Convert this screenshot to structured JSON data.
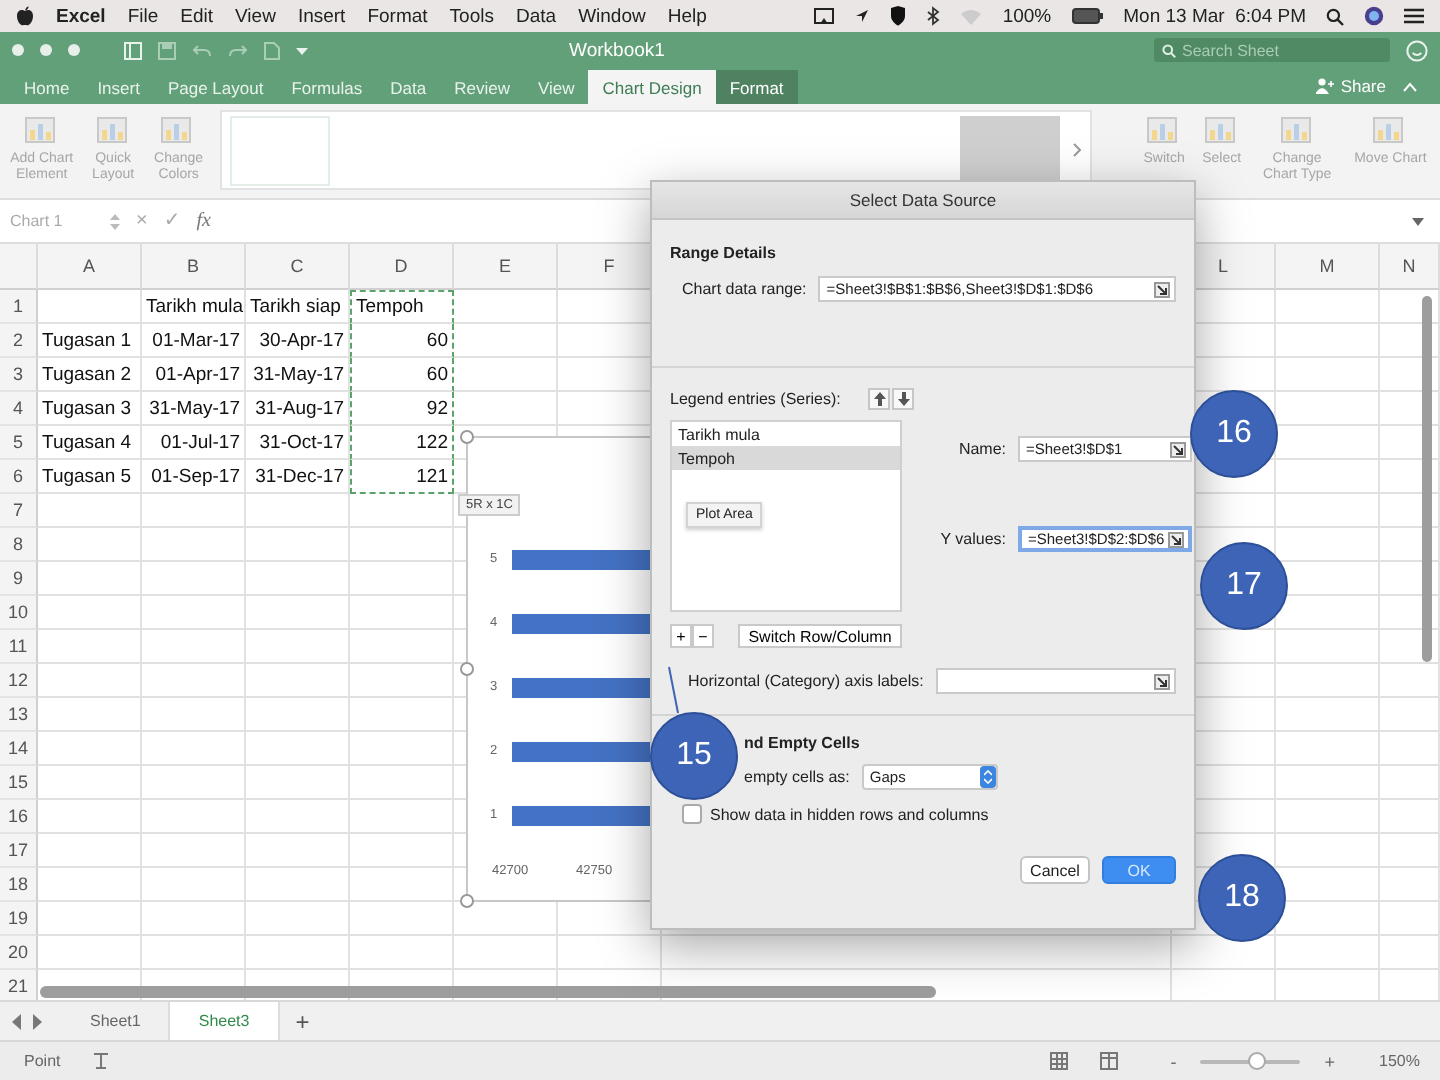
{
  "menu_bar": {
    "app": "Excel",
    "items": [
      "File",
      "Edit",
      "View",
      "Insert",
      "Format",
      "Tools",
      "Data",
      "Window",
      "Help"
    ],
    "battery": "100%",
    "clock": "Mon 13 Mar  6:04 PM"
  },
  "title_bar": {
    "title": "Workbook1",
    "search": {
      "placeholder": "Search Sheet"
    }
  },
  "ribbon_tabs": [
    {
      "label": "Home",
      "selected": false,
      "kind": "normal"
    },
    {
      "label": "Insert",
      "selected": false,
      "kind": "normal"
    },
    {
      "label": "Page Layout",
      "selected": false,
      "kind": "normal"
    },
    {
      "label": "Formulas",
      "selected": false,
      "kind": "normal"
    },
    {
      "label": "Data",
      "selected": false,
      "kind": "normal"
    },
    {
      "label": "Review",
      "selected": false,
      "kind": "normal"
    },
    {
      "label": "View",
      "selected": false,
      "kind": "normal"
    },
    {
      "label": "Chart Design",
      "selected": true,
      "kind": "contextual"
    },
    {
      "label": "Format",
      "selected": false,
      "kind": "contextual"
    }
  ],
  "share": "Share",
  "ribbon": {
    "left": [
      "Add Chart Element",
      "Quick Layout",
      "Change Colors"
    ],
    "right": [
      "Switch",
      "Select",
      "Change Chart Type",
      "Move Chart"
    ]
  },
  "formula_bar": {
    "name_box": "Chart 1",
    "cancel": "×",
    "enter": "✓",
    "fx": "fx"
  },
  "sheet": {
    "columns_left": [
      "A",
      "B",
      "C",
      "D",
      "E",
      "F"
    ],
    "columns_right": [
      "L",
      "M",
      "N"
    ],
    "rows": [
      {
        "label": "1",
        "cells": [
          null,
          {
            "text": "Tarikh mula",
            "kind": "text",
            "in_range": false
          },
          {
            "text": "Tarikh siap",
            "kind": "text",
            "in_range": false
          },
          {
            "text": "Tempoh",
            "kind": "text",
            "in_range": true
          }
        ]
      },
      {
        "label": "2",
        "cells": [
          {
            "text": "Tugasan 1",
            "kind": "text",
            "in_range": false
          },
          {
            "text": "01-Mar-17",
            "kind": "number",
            "in_range": false
          },
          {
            "text": "30-Apr-17",
            "kind": "number",
            "in_range": false
          },
          {
            "text": "60",
            "kind": "number",
            "in_range": true
          }
        ]
      },
      {
        "label": "3",
        "cells": [
          {
            "text": "Tugasan 2",
            "kind": "text",
            "in_range": false
          },
          {
            "text": "01-Apr-17",
            "kind": "number",
            "in_range": false
          },
          {
            "text": "31-May-17",
            "kind": "number",
            "in_range": false
          },
          {
            "text": "60",
            "kind": "number",
            "in_range": true
          }
        ]
      },
      {
        "label": "4",
        "cells": [
          {
            "text": "Tugasan 3",
            "kind": "text",
            "in_range": false
          },
          {
            "text": "31-May-17",
            "kind": "number",
            "in_range": false
          },
          {
            "text": "31-Aug-17",
            "kind": "number",
            "in_range": false
          },
          {
            "text": "92",
            "kind": "number",
            "in_range": true
          }
        ]
      },
      {
        "label": "5",
        "cells": [
          {
            "text": "Tugasan 4",
            "kind": "text",
            "in_range": false
          },
          {
            "text": "01-Jul-17",
            "kind": "number",
            "in_range": false
          },
          {
            "text": "31-Oct-17",
            "kind": "number",
            "in_range": false
          },
          {
            "text": "122",
            "kind": "number",
            "in_range": true
          }
        ]
      },
      {
        "label": "6",
        "cells": [
          {
            "text": "Tugasan 5",
            "kind": "text",
            "in_range": false
          },
          {
            "text": "01-Sep-17",
            "kind": "number",
            "in_range": false
          },
          {
            "text": "31-Dec-17",
            "kind": "number",
            "in_range": false
          },
          {
            "text": "121",
            "kind": "number",
            "in_range": true
          }
        ]
      },
      {
        "label": "7",
        "cells": []
      },
      {
        "label": "8",
        "cells": []
      },
      {
        "label": "9",
        "cells": []
      },
      {
        "label": "10",
        "cells": []
      },
      {
        "label": "11",
        "cells": []
      },
      {
        "label": "12",
        "cells": []
      },
      {
        "label": "13",
        "cells": []
      },
      {
        "label": "14",
        "cells": []
      },
      {
        "label": "15",
        "cells": []
      },
      {
        "label": "16",
        "cells": []
      },
      {
        "label": "17",
        "cells": []
      },
      {
        "label": "18",
        "cells": []
      },
      {
        "label": "19",
        "cells": []
      },
      {
        "label": "20",
        "cells": []
      },
      {
        "label": "21",
        "cells": []
      }
    ]
  },
  "chart": {
    "tooltip": "5R x 1C",
    "category_labels": [
      "5",
      "4",
      "3",
      "2",
      "1"
    ],
    "axis_labels": [
      "42700",
      "42750"
    ]
  },
  "dialog": {
    "title": "Select Data Source",
    "range_heading": "Range Details",
    "chart_range": {
      "label": "Chart data range:",
      "value": "=Sheet3!$B$1:$B$6,Sheet3!$D$1:$D$6"
    },
    "legend_label": "Legend entries (Series):",
    "series": [
      {
        "label": "Tarikh mula",
        "selected": false
      },
      {
        "label": "Tempoh",
        "selected": true
      }
    ],
    "tooltip": "Plot Area",
    "add": "+",
    "remove": "−",
    "switch_button": "Switch Row/Column",
    "name_field": {
      "label": "Name:",
      "value": "=Sheet3!$D$1",
      "focused": false
    },
    "y_field": {
      "label": "Y values:",
      "value": "=Sheet3!$D$2:$D$6",
      "focused": true
    },
    "axis_field": {
      "label": "Horizontal (Category) axis labels:"
    },
    "hidden_heading": "nd Empty Cells",
    "empty_label": "empty cells as:",
    "empty_value": "Gaps",
    "show_hidden": {
      "label": "Show data in hidden rows and columns",
      "checked": false
    },
    "buttons": [
      {
        "label": "Cancel",
        "kind": "secondary"
      },
      {
        "label": "OK",
        "kind": "primary"
      }
    ]
  },
  "callouts": [
    "15",
    "16",
    "17",
    "18"
  ],
  "sheet_tabs": [
    {
      "label": "Sheet1",
      "selected": false
    },
    {
      "label": "Sheet3",
      "selected": true
    }
  ],
  "add_sheet": "+",
  "status_bar": {
    "mode": "Point",
    "zoom": {
      "minus": "-",
      "plus": "+",
      "level": 0.55,
      "reading": "150%"
    }
  }
}
